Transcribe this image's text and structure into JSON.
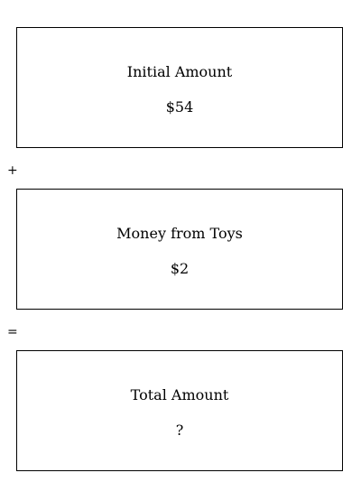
{
  "boxes": [
    {
      "label": "Initial Amount",
      "value": "$54"
    },
    {
      "label": "Money from Toys",
      "value": "$2"
    },
    {
      "label": "Total Amount",
      "value": "?"
    }
  ],
  "operators": {
    "plus": "+",
    "equals": "="
  }
}
